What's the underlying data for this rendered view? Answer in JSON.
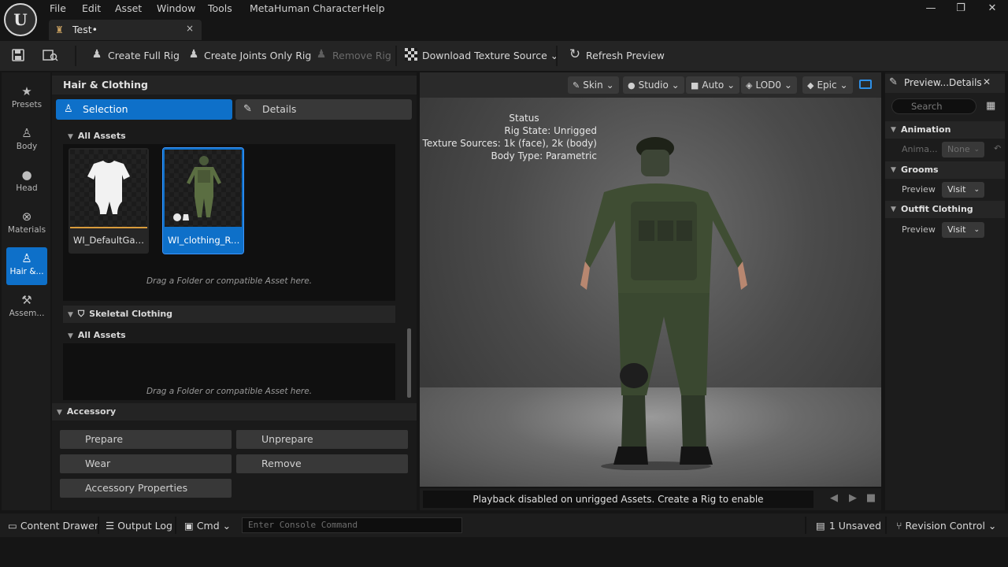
{
  "menu": [
    "File",
    "Edit",
    "Asset",
    "Window",
    "Tools",
    "MetaHuman Character",
    "Help"
  ],
  "tab": {
    "title": "Test•",
    "close": "×"
  },
  "window_controls": {
    "minimize": "—",
    "maximize": "❐",
    "close": "✕"
  },
  "toolbar": {
    "create_full_rig": "Create Full Rig",
    "create_joints_only_rig": "Create Joints Only Rig",
    "remove_rig": "Remove Rig",
    "download_texture_source": "Download Texture Source",
    "refresh_preview": "Refresh Preview"
  },
  "nav": [
    {
      "label": "Presets",
      "icon": "star-icon"
    },
    {
      "label": "Body",
      "icon": "body-icon"
    },
    {
      "label": "Head",
      "icon": "head-icon"
    },
    {
      "label": "Materials",
      "icon": "materials-icon"
    },
    {
      "label": "Hair &...",
      "icon": "hair-clothing-icon",
      "active": true
    },
    {
      "label": "Assem...",
      "icon": "assembly-icon"
    }
  ],
  "panel": {
    "title": "Hair & Clothing",
    "selection_tab": "Selection",
    "details_tab": "Details",
    "all_assets": "All Assets",
    "assets": [
      {
        "name": "WI_DefaultGarment",
        "selected": false
      },
      {
        "name": "WI_clothing_Rus...",
        "selected": true
      }
    ],
    "drop_hint": "Drag a Folder or compatible Asset here.",
    "skeletal_clothing": "Skeletal Clothing",
    "all_assets_2": "All Assets",
    "drop_hint_2": "Drag a Folder or compatible Asset here.",
    "accessory": "Accessory",
    "buttons": {
      "prepare": "Prepare",
      "unprepare": "Unprepare",
      "wear": "Wear",
      "remove": "Remove",
      "accessory_properties": "Accessory Properties"
    }
  },
  "viewport": {
    "skin": "Skin",
    "studio": "Studio",
    "auto": "Auto",
    "lod": "LOD0",
    "quality": "Epic",
    "status_title": "Status",
    "rig_state": "Rig State: Unrigged",
    "texture_sources": "Texture Sources: 1k (face), 2k (body)",
    "body_type": "Body Type: Parametric",
    "playback_message": "Playback disabled on unrigged Assets. Create a Rig to enable"
  },
  "details": {
    "title": "Preview...Details",
    "search_placeholder": "Search",
    "animation": "Animation",
    "anim_label": "Anima...",
    "anim_value": "None",
    "grooms": "Grooms",
    "grooms_preview": "Preview",
    "grooms_value": "Visit",
    "outfit_clothing": "Outfit Clothing",
    "outfit_preview": "Preview",
    "outfit_value": "Visit"
  },
  "statusbar": {
    "content_drawer": "Content Drawer",
    "output_log": "Output Log",
    "cmd": "Cmd",
    "console_placeholder": "Enter Console Command",
    "unsaved": "1 Unsaved",
    "revision_control": "Revision Control"
  }
}
